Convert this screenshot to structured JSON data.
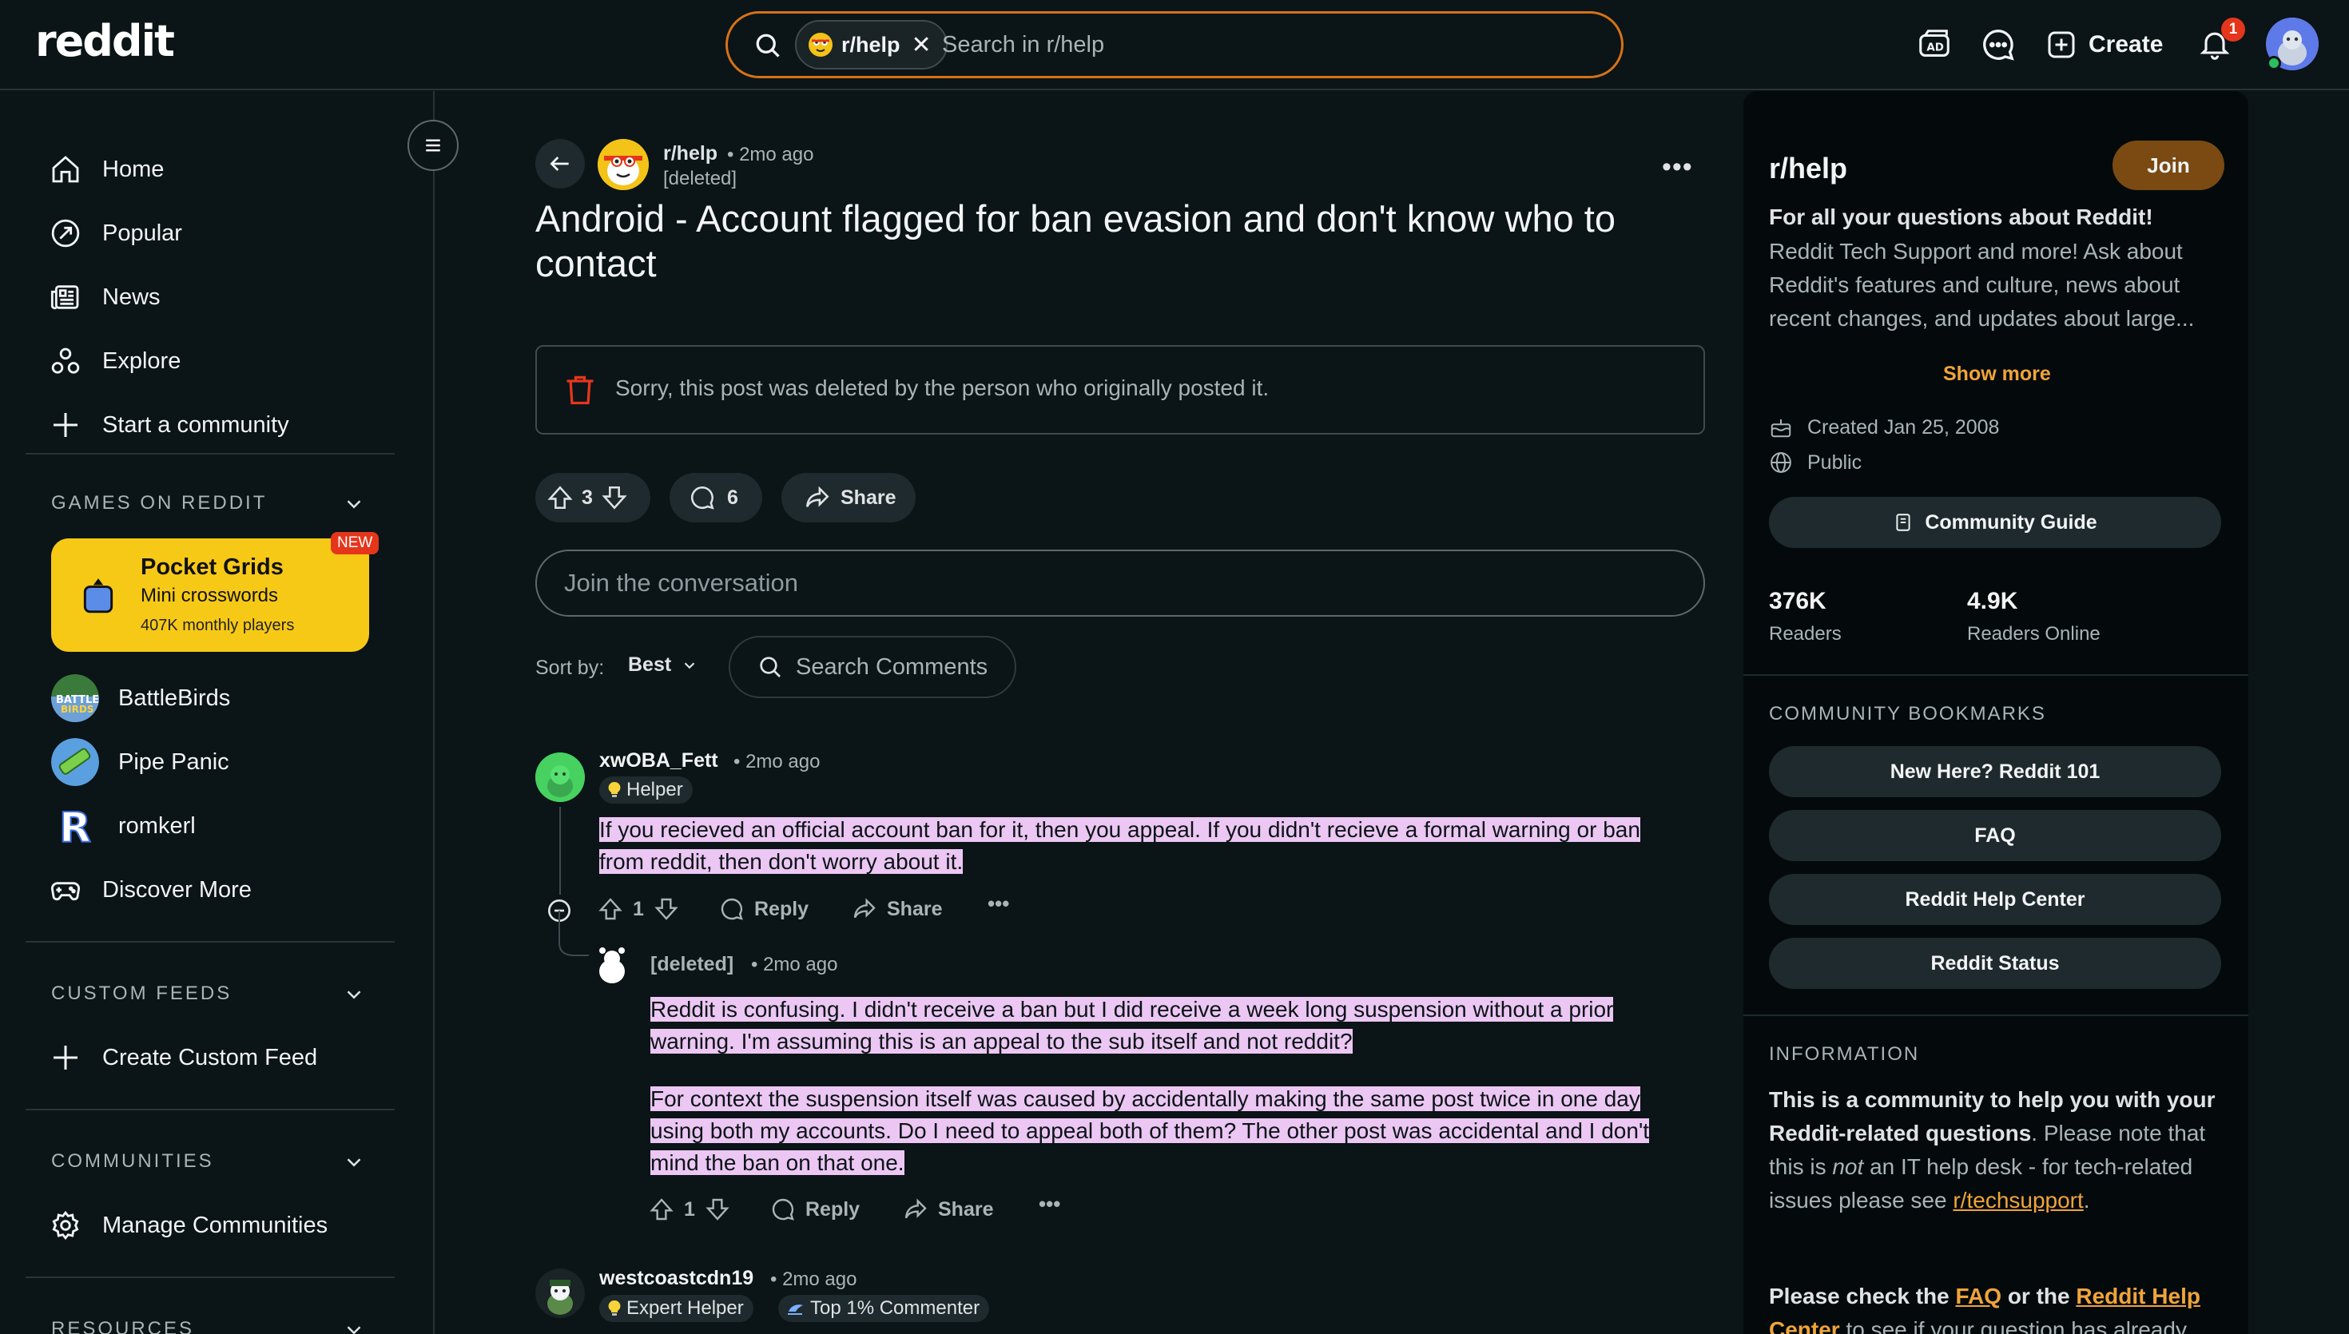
{
  "header": {
    "logo": "reddit",
    "search_chip": "r/help",
    "search_placeholder": "Search in r/help",
    "create_label": "Create",
    "notification_count": "1"
  },
  "leftnav": {
    "items": [
      {
        "label": "Home",
        "icon": "home-icon"
      },
      {
        "label": "Popular",
        "icon": "popular-icon"
      },
      {
        "label": "News",
        "icon": "news-icon"
      },
      {
        "label": "Explore",
        "icon": "explore-icon"
      },
      {
        "label": "Start a community",
        "icon": "plus-icon"
      }
    ],
    "games_title": "GAMES ON REDDIT",
    "featured_game": {
      "title": "Pocket Grids",
      "subtitle": "Mini crosswords",
      "players": "407K monthly players",
      "badge": "NEW"
    },
    "games": [
      "BattleBirds",
      "Pipe Panic",
      "romkerl",
      "Discover More"
    ],
    "custom_feeds_title": "CUSTOM FEEDS",
    "create_custom_feed": "Create Custom Feed",
    "communities_title": "COMMUNITIES",
    "manage_communities": "Manage Communities",
    "resources_title": "RESOURCES"
  },
  "post": {
    "subreddit": "r/help",
    "time": "• 2mo ago",
    "author": "[deleted]",
    "title": "Android - Account flagged for ban evasion and don't know who to contact",
    "deleted_notice": "Sorry, this post was deleted by the person who originally posted it.",
    "votes": "3",
    "comments": "6",
    "share_label": "Share",
    "join_placeholder": "Join the conversation",
    "sort_label": "Sort by:",
    "sort_value": "Best",
    "search_comments": "Search Comments"
  },
  "comments": [
    {
      "author": "xwOBA_Fett",
      "time": "• 2mo ago",
      "flair": "Helper",
      "lines": [
        "If you recieved an official account ban for it, then you appeal. If you didn't recieve a formal warning or ban",
        "from reddit, then don't worry about it."
      ],
      "votes": "1",
      "reply": "Reply",
      "share": "Share"
    },
    {
      "author": "[deleted]",
      "time": "• 2mo ago",
      "para1": [
        "Reddit is confusing. I didn't receive a ban but I did receive a week long suspension without a prior",
        "warning. I'm assuming this is an appeal to the sub itself and not reddit?"
      ],
      "para2": [
        "For context the suspension itself was caused by accidentally making the same post twice in one day",
        "using both my accounts. Do I need to appeal both of them? The other post was accidental and I don't",
        "mind the ban on that one."
      ],
      "votes": "1",
      "reply": "Reply",
      "share": "Share"
    },
    {
      "author": "westcoastcdn19",
      "time": "• 2mo ago",
      "flair1": "Expert Helper",
      "flair2": "Top 1% Commenter"
    }
  ],
  "sidebar": {
    "title": "r/help",
    "join": "Join",
    "tagline": "For all your questions about Reddit!",
    "description_lines": [
      "Reddit Tech Support and more! Ask about",
      "Reddit's features and culture, news about",
      "recent changes, and updates about large..."
    ],
    "show_more": "Show more",
    "created": "Created Jan 25, 2008",
    "visibility": "Public",
    "guide": "Community Guide",
    "readers": "376K",
    "readers_label": "Readers",
    "online": "4.9K",
    "online_label": "Readers Online",
    "bookmarks_title": "COMMUNITY BOOKMARKS",
    "bookmarks": [
      "New Here? Reddit 101",
      "FAQ",
      "Reddit Help Center",
      "Reddit Status"
    ],
    "info_title": "INFORMATION",
    "info_bold": "This is a community to help you with your Reddit-related questions",
    "info_rest_a": ". Please note that this is ",
    "info_not": "not",
    "info_rest_b": " an IT help desk - for tech-related issues please see ",
    "info_link": "r/techsupport",
    "info_end": ".",
    "info2_a": "Please check the ",
    "info2_faq": "FAQ",
    "info2_b": " or the ",
    "info2_help": "Reddit Help Center",
    "info2_c": " to see if your question has already"
  },
  "colors": {
    "background": "#0b1416",
    "accent_orange": "#d67217",
    "highlight": "#ecc7f3",
    "game_card": "#f7c917",
    "join_button": "#7a4a12"
  }
}
